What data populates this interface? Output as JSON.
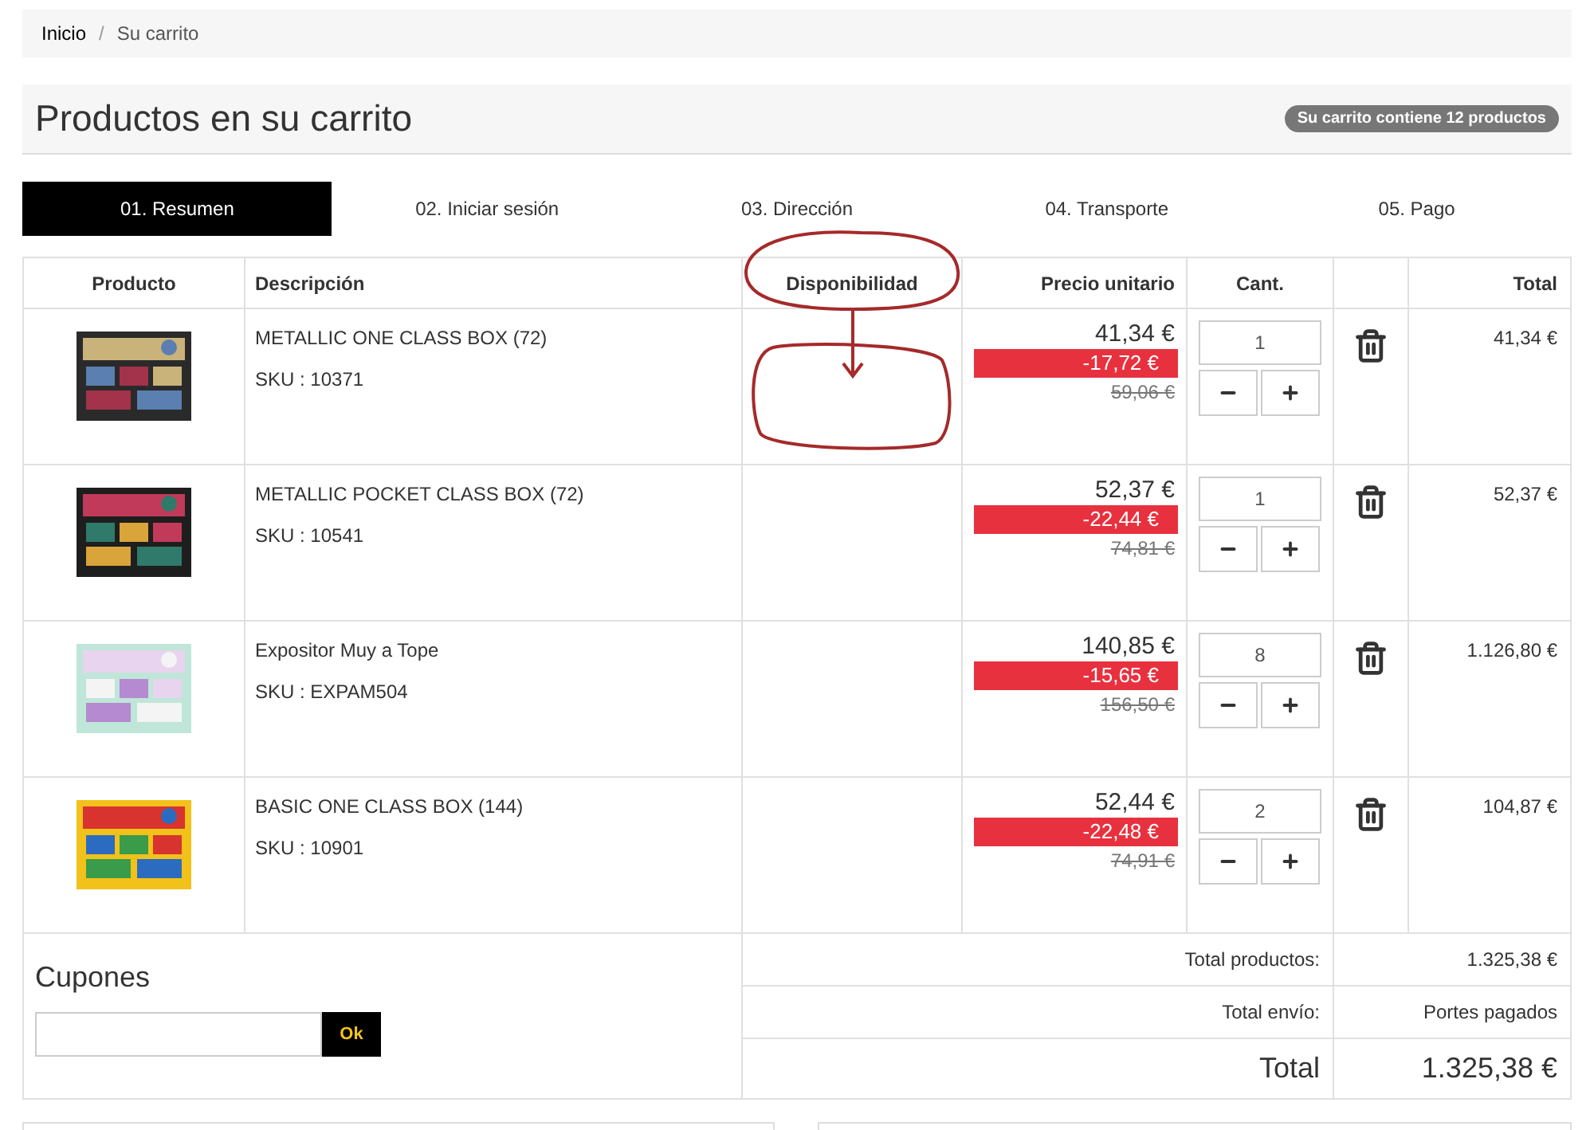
{
  "breadcrumb": [
    {
      "label": "Inicio"
    },
    {
      "label": "Su carrito"
    }
  ],
  "breadcrumb_separator": "/",
  "header": {
    "title": "Productos en su carrito",
    "badge": "Su carrito contiene 12 productos"
  },
  "steps": [
    {
      "label": "01. Resumen",
      "selected": true
    },
    {
      "label": "02. Iniciar sesión",
      "selected": false
    },
    {
      "label": "03. Dirección",
      "selected": false
    },
    {
      "label": "04. Transporte",
      "selected": false
    },
    {
      "label": "05. Pago",
      "selected": false
    }
  ],
  "table": {
    "columns": [
      "Producto",
      "Descripción",
      "Disponibilidad",
      "Precio unitario",
      "Cant.",
      "Total"
    ],
    "rows": [
      {
        "name": "METALLIC ONE CLASS BOX (72)",
        "sku": "SKU : 10371",
        "price": "41,34 €",
        "discount": "-17,72 €",
        "old_price": "59,06 €",
        "quantity": "1",
        "total": "41,34 €"
      },
      {
        "name": "METALLIC POCKET CLASS BOX (72)",
        "sku": "SKU : 10541",
        "price": "52,37 €",
        "discount": "-22,44 €",
        "old_price": "74,81 €",
        "quantity": "1",
        "total": "52,37 €"
      },
      {
        "name": "Expositor Muy a Tope",
        "sku": "SKU : EXPAM504",
        "price": "140,85 €",
        "discount": "-15,65 €",
        "old_price": "156,50 €",
        "quantity": "8",
        "total": "1.126,80 €"
      },
      {
        "name": "BASIC ONE CLASS BOX (144)",
        "sku": "SKU : 10901",
        "price": "52,44 €",
        "discount": "-22,48 €",
        "old_price": "74,91 €",
        "quantity": "2",
        "total": "104,87 €"
      }
    ]
  },
  "coupons": {
    "title": "Cupones",
    "button": "Ok"
  },
  "summary": [
    {
      "label": "Total productos:",
      "value": "1.325,38 €",
      "kind": "normal"
    },
    {
      "label": "Total envío:",
      "value": "Portes pagados",
      "kind": "normal"
    },
    {
      "label": "Total",
      "value": "1.325,38 €",
      "kind": "grand"
    }
  ]
}
